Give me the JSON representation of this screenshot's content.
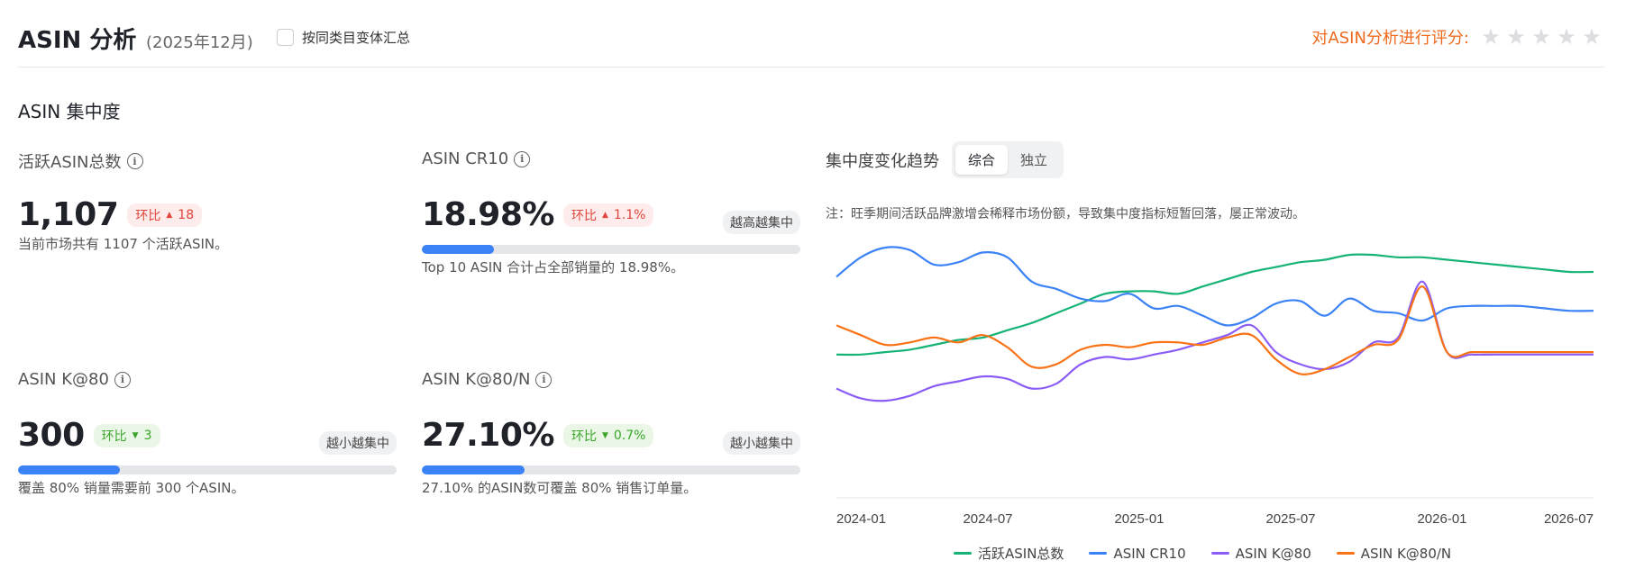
{
  "header": {
    "title": "ASIN 分析",
    "period": "(2025年12月)",
    "group_check_label": "按同类目变体汇总",
    "rating_label": "对ASIN分析进行评分:",
    "stars": 5
  },
  "section": {
    "title": "ASIN 集中度"
  },
  "cards": {
    "active": {
      "label": "活跃ASIN总数",
      "value": "1,107",
      "change_label": "环比",
      "change_dir": "up",
      "change_value": "18",
      "desc": "当前市场共有 1107 个活跃ASIN。"
    },
    "cr10": {
      "label": "ASIN CR10",
      "value": "18.98%",
      "change_label": "环比",
      "change_dir": "up",
      "change_value": "1.1%",
      "tag": "越高越集中",
      "progress": 0.19,
      "desc": "Top 10 ASIN 合计占全部销量的 18.98%。"
    },
    "k80": {
      "label": "ASIN K@80",
      "value": "300",
      "change_label": "环比",
      "change_dir": "down",
      "change_value": "3",
      "tag": "越小越集中",
      "progress": 0.27,
      "desc": "覆盖 80% 销量需要前 300 个ASIN。"
    },
    "k80n": {
      "label": "ASIN K@80/N",
      "value": "27.10%",
      "change_label": "环比",
      "change_dir": "down",
      "change_value": "0.7%",
      "tag": "越小越集中",
      "progress": 0.271,
      "desc": "27.10% 的ASIN数可覆盖 80% 销售订单量。"
    }
  },
  "trend": {
    "title": "集中度变化趋势",
    "tabs": [
      "综合",
      "独立"
    ],
    "active_tab": "综合",
    "note": "注：旺季期间活跃品牌激增会稀释市场份额，导致集中度指标短暂回落，屡正常波动。"
  },
  "chart_data": {
    "type": "line",
    "x_ticks": [
      "2024-01",
      "2024-07",
      "2025-01",
      "2025-07",
      "2026-01",
      "2026-07"
    ],
    "y_axis_labels": false,
    "grid": false,
    "legend_position": "bottom",
    "normalized": true,
    "x": [
      0,
      1,
      2,
      3,
      4,
      5,
      6,
      7,
      8,
      9,
      10,
      11,
      12,
      13,
      14,
      15,
      16,
      17,
      18,
      19,
      20,
      21,
      22,
      23,
      24,
      25,
      26,
      27,
      28,
      29,
      30,
      31
    ],
    "series": [
      {
        "name": "活跃ASIN总数",
        "color": "#16b377",
        "values": [
          0.56,
          0.56,
          0.57,
          0.58,
          0.6,
          0.62,
          0.63,
          0.66,
          0.69,
          0.73,
          0.77,
          0.81,
          0.82,
          0.82,
          0.81,
          0.84,
          0.87,
          0.9,
          0.92,
          0.94,
          0.95,
          0.97,
          0.97,
          0.96,
          0.96,
          0.95,
          0.94,
          0.93,
          0.92,
          0.91,
          0.9,
          0.9
        ]
      },
      {
        "name": "ASIN CR10",
        "color": "#3b82f6",
        "values": [
          0.88,
          0.96,
          1.0,
          0.99,
          0.93,
          0.94,
          0.98,
          0.96,
          0.86,
          0.83,
          0.79,
          0.78,
          0.81,
          0.75,
          0.76,
          0.72,
          0.68,
          0.71,
          0.77,
          0.78,
          0.72,
          0.79,
          0.74,
          0.73,
          0.7,
          0.75,
          0.76,
          0.76,
          0.76,
          0.75,
          0.74,
          0.74
        ]
      },
      {
        "name": "ASIN K@80",
        "color": "#8b5cf6",
        "values": [
          0.42,
          0.38,
          0.37,
          0.39,
          0.43,
          0.45,
          0.47,
          0.46,
          0.42,
          0.44,
          0.52,
          0.55,
          0.54,
          0.56,
          0.58,
          0.61,
          0.64,
          0.68,
          0.57,
          0.52,
          0.5,
          0.53,
          0.61,
          0.63,
          0.86,
          0.57,
          0.56,
          0.56,
          0.56,
          0.56,
          0.56,
          0.56
        ]
      },
      {
        "name": "ASIN K@80/N",
        "color": "#f97316",
        "values": [
          0.68,
          0.64,
          0.6,
          0.61,
          0.63,
          0.61,
          0.64,
          0.59,
          0.51,
          0.52,
          0.58,
          0.6,
          0.59,
          0.61,
          0.61,
          0.6,
          0.63,
          0.64,
          0.54,
          0.48,
          0.5,
          0.55,
          0.6,
          0.62,
          0.84,
          0.57,
          0.57,
          0.57,
          0.57,
          0.57,
          0.57,
          0.57
        ]
      }
    ]
  }
}
